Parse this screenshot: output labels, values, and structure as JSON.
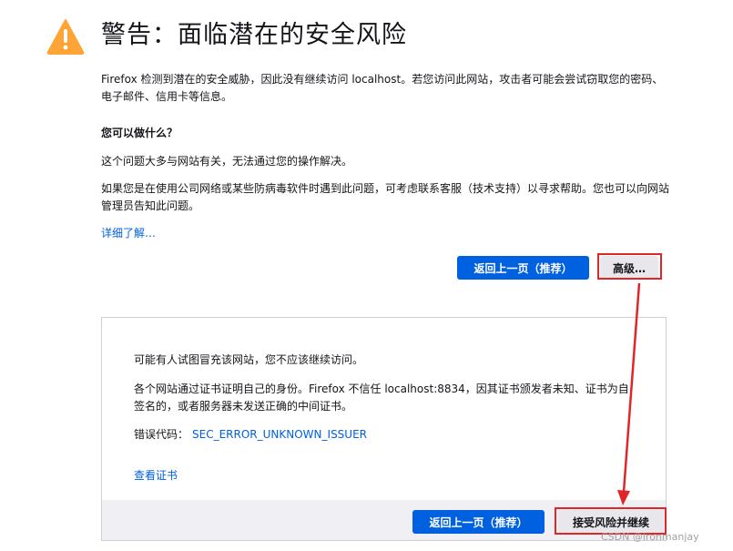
{
  "page": {
    "title": "警告：面临潜在的安全风险",
    "intro": "Firefox 检测到潜在的安全威胁，因此没有继续访问 localhost。若您访问此网站，攻击者可能会尝试窃取您的密码、电子邮件、信用卡等信息。",
    "what_can_you_do": "您可以做什么？",
    "para1": "这个问题大多与网站有关，无法通过您的操作解决。",
    "para2": "如果您是在使用公司网络或某些防病毒软件时遇到此问题，可考虑联系客服（技术支持）以寻求帮助。您也可以向网站管理员告知此问题。",
    "learn_more": "详细了解…"
  },
  "buttons": {
    "go_back": "返回上一页（推荐）",
    "advanced": "高级…"
  },
  "advanced_panel": {
    "line1": "可能有人试图冒充该网站，您不应该继续访问。",
    "line2": "各个网站通过证书证明自己的身份。Firefox 不信任 localhost:8834，因其证书颁发者未知、证书为自签名的，或者服务器未发送正确的中间证书。",
    "error_label": "错误代码：",
    "error_code": "SEC_ERROR_UNKNOWN_ISSUER",
    "view_cert": "查看证书",
    "go_back": "返回上一页（推荐）",
    "accept": "接受风险并继续"
  },
  "watermark": "CSDN @ironmanjay",
  "colors": {
    "accent": "#0061e0",
    "warning": "#ffa436",
    "annotation_red": "#e1262a"
  },
  "icons": {
    "warning": "warning-triangle-icon"
  }
}
